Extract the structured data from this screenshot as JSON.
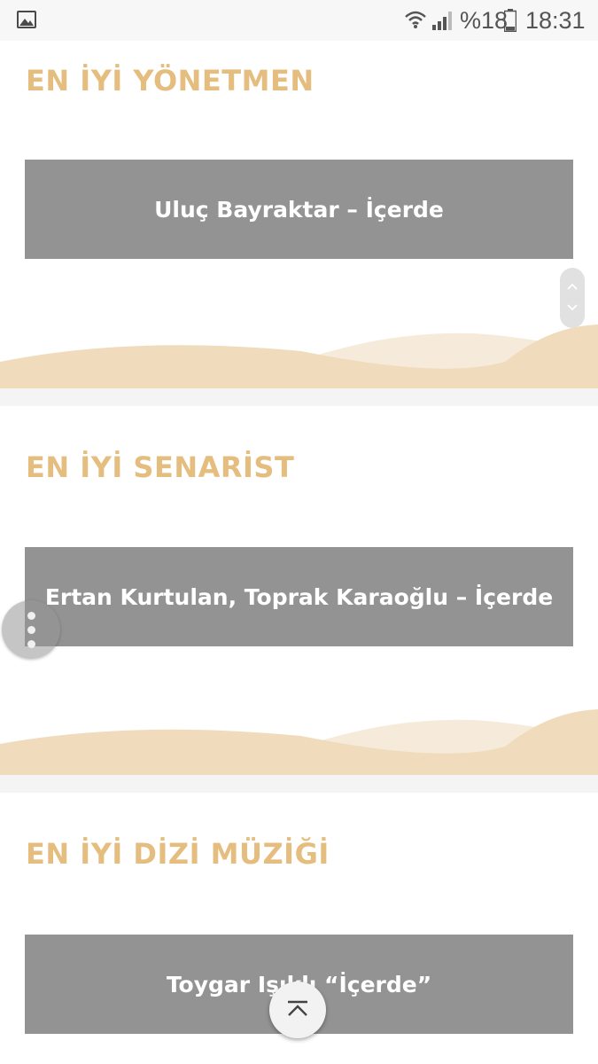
{
  "status_bar": {
    "icons": [
      "gallery-icon",
      "wifi-icon",
      "signal-icon",
      "battery-icon"
    ],
    "battery": "%18",
    "time": "18:31"
  },
  "sections": [
    {
      "title": "EN İYİ YÖNETMEN",
      "winner": "Uluç Bayraktar – İçerde"
    },
    {
      "title": "EN İYİ SENARİST",
      "winner": "Ertan Kurtulan, Toprak Karaoğlu – İçerde"
    },
    {
      "title": "EN İYİ DİZİ MÜZİĞİ",
      "winner": "Toygar Işıklı “İçerde”"
    }
  ],
  "widgets": {
    "scroll_icons": [
      "chevron-up-icon",
      "chevron-down-icon"
    ],
    "menu_icon": "more-vertical-icon",
    "back_to_top_icon": "arrow-to-top-icon"
  },
  "colors": {
    "title": "#e4bd7f",
    "winner_box": "#939393",
    "wave_primary": "#f0dcbc",
    "wave_secondary": "#f6ebda"
  }
}
